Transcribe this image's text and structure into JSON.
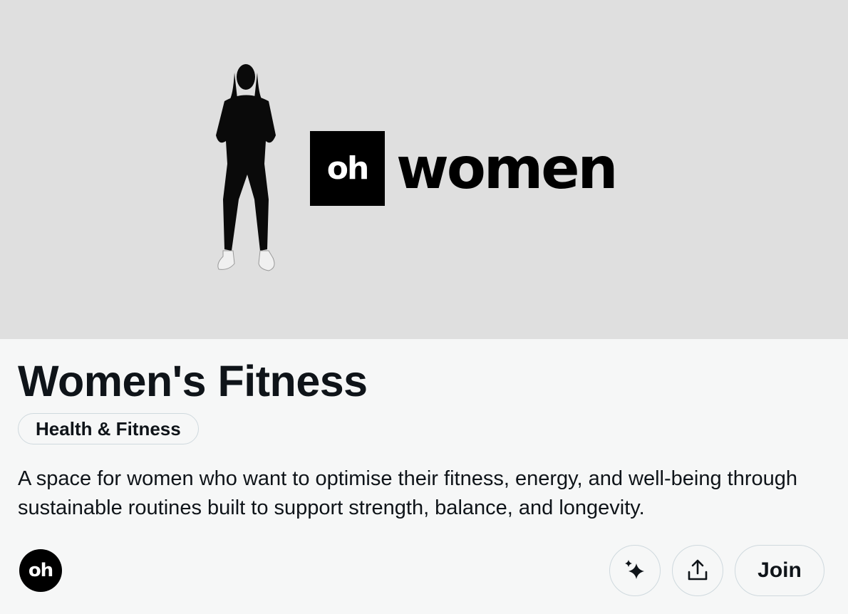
{
  "banner": {
    "logo_mark": "oh",
    "logo_word": "women"
  },
  "community": {
    "title": "Women's Fitness",
    "category": "Health & Fitness",
    "description": "A space for women who want to optimise their fitness, energy, and well-being through sustainable routines built to support strength, balance, and longevity.",
    "avatar_text": "oh"
  },
  "actions": {
    "sparkle_icon": "sparkle-icon",
    "share_icon": "share-icon",
    "join_label": "Join"
  }
}
